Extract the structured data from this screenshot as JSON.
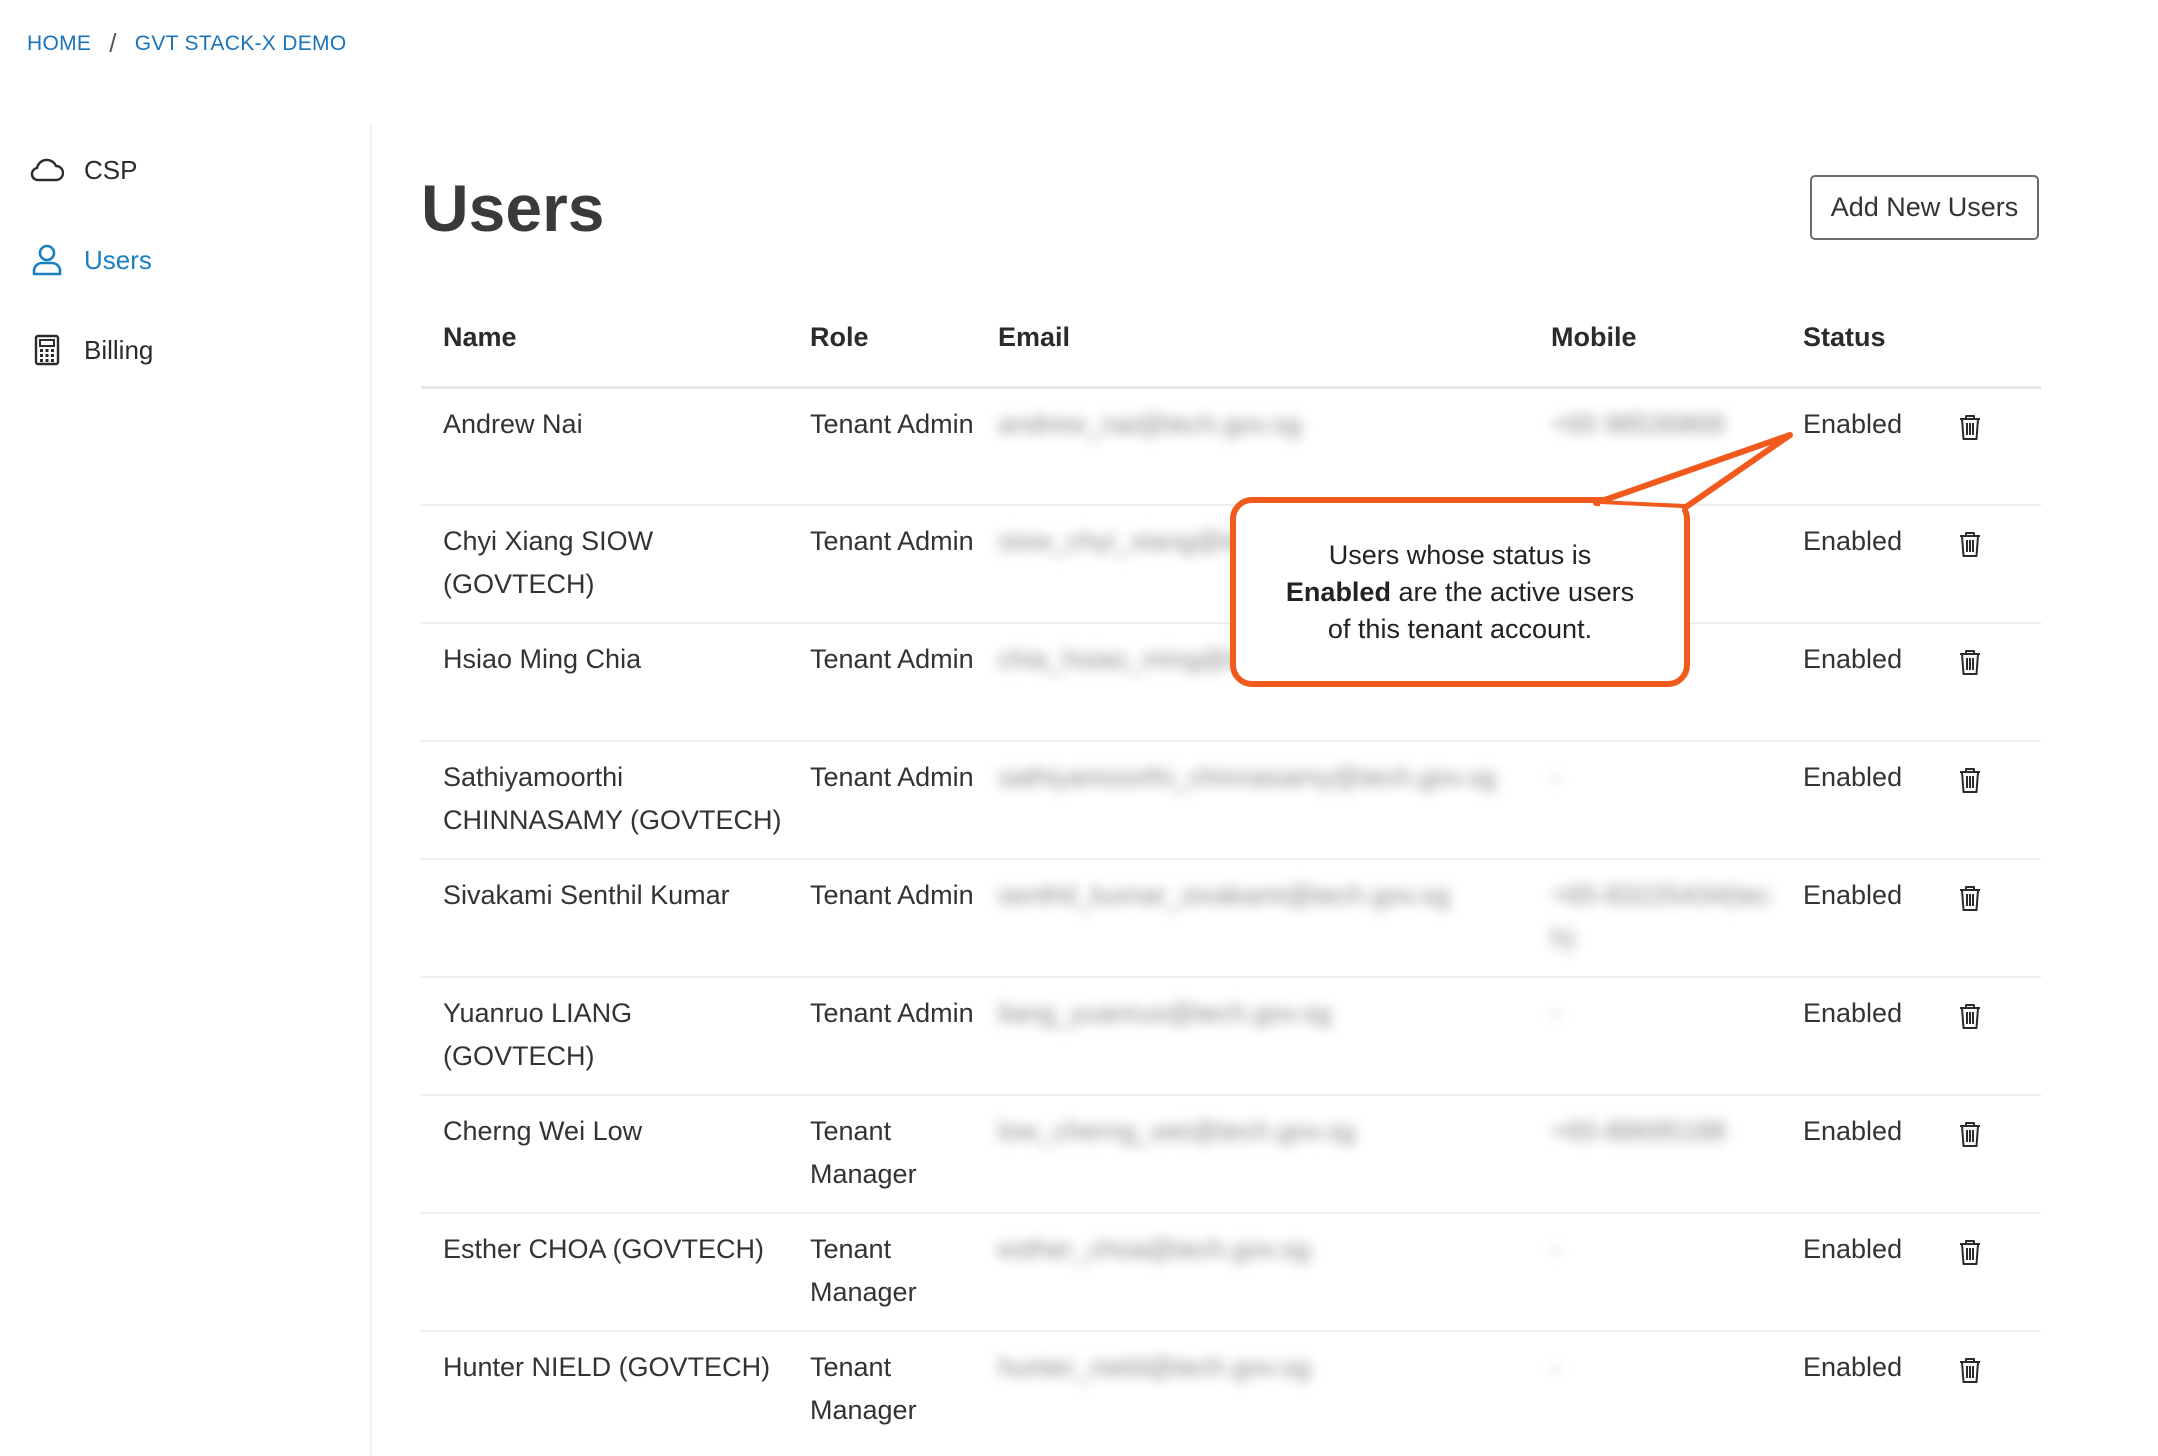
{
  "breadcrumb": {
    "home": "HOME",
    "separator": "/",
    "current": "GVT STACK-X DEMO"
  },
  "sidebar": {
    "items": [
      {
        "label": "CSP",
        "icon": "cloud-icon"
      },
      {
        "label": "Users",
        "icon": "user-icon",
        "active": true
      },
      {
        "label": "Billing",
        "icon": "calculator-icon"
      }
    ]
  },
  "main": {
    "title": "Users",
    "add_button": "Add New Users"
  },
  "table": {
    "headers": {
      "name": "Name",
      "role": "Role",
      "email": "Email",
      "mobile": "Mobile",
      "status": "Status"
    },
    "rows": [
      {
        "name": "Andrew Nai",
        "role": "Tenant Admin",
        "email": "andrew_nai@tech.gov.sg",
        "mobile": "+65 98536868",
        "status": "Enabled"
      },
      {
        "name": "Chyi Xiang SIOW (GOVTECH)",
        "role": "Tenant Admin",
        "email": "siow_chyi_xiang@tech.gov.sg",
        "mobile": "",
        "status": "Enabled"
      },
      {
        "name": "Hsiao Ming Chia",
        "role": "Tenant Admin",
        "email": "chia_hsiao_ming@tech.gov.sg",
        "mobile": "",
        "status": "Enabled"
      },
      {
        "name": "Sathiyamoorthi CHINNASAMY (GOVTECH)",
        "role": "Tenant Admin",
        "email": "sathiyamoorthi_chinnasamy@tech.gov.sg",
        "mobile": "-",
        "status": "Enabled"
      },
      {
        "name": "Sivakami Senthil Kumar",
        "role": "Tenant Admin",
        "email": "senthil_kumar_sivakami@tech.gov.sg",
        "mobile": "+65-83225434(tech)",
        "status": "Enabled"
      },
      {
        "name": "Yuanruo LIANG (GOVTECH)",
        "role": "Tenant Admin",
        "email": "liang_yuanruo@tech.gov.sg",
        "mobile": "-",
        "status": "Enabled"
      },
      {
        "name": "Cherng Wei Low",
        "role": "Tenant Manager",
        "email": "low_cherng_wei@tech.gov.sg",
        "mobile": "+65-88695188",
        "status": "Enabled"
      },
      {
        "name": "Esther CHOA (GOVTECH)",
        "role": "Tenant Manager",
        "email": "esther_choa@tech.gov.sg",
        "mobile": "-",
        "status": "Enabled"
      },
      {
        "name": "Hunter NIELD (GOVTECH)",
        "role": "Tenant Manager",
        "email": "hunter_nield@tech.gov.sg",
        "mobile": "-",
        "status": "Enabled"
      }
    ]
  },
  "callout": {
    "line1": "Users whose status is",
    "bold": "Enabled",
    "line2": " are the active users",
    "line3": "of this tenant account.",
    "border_color": "#f15a1c"
  },
  "colors": {
    "link": "#1a73b8",
    "active_nav": "#1a7fbf"
  }
}
